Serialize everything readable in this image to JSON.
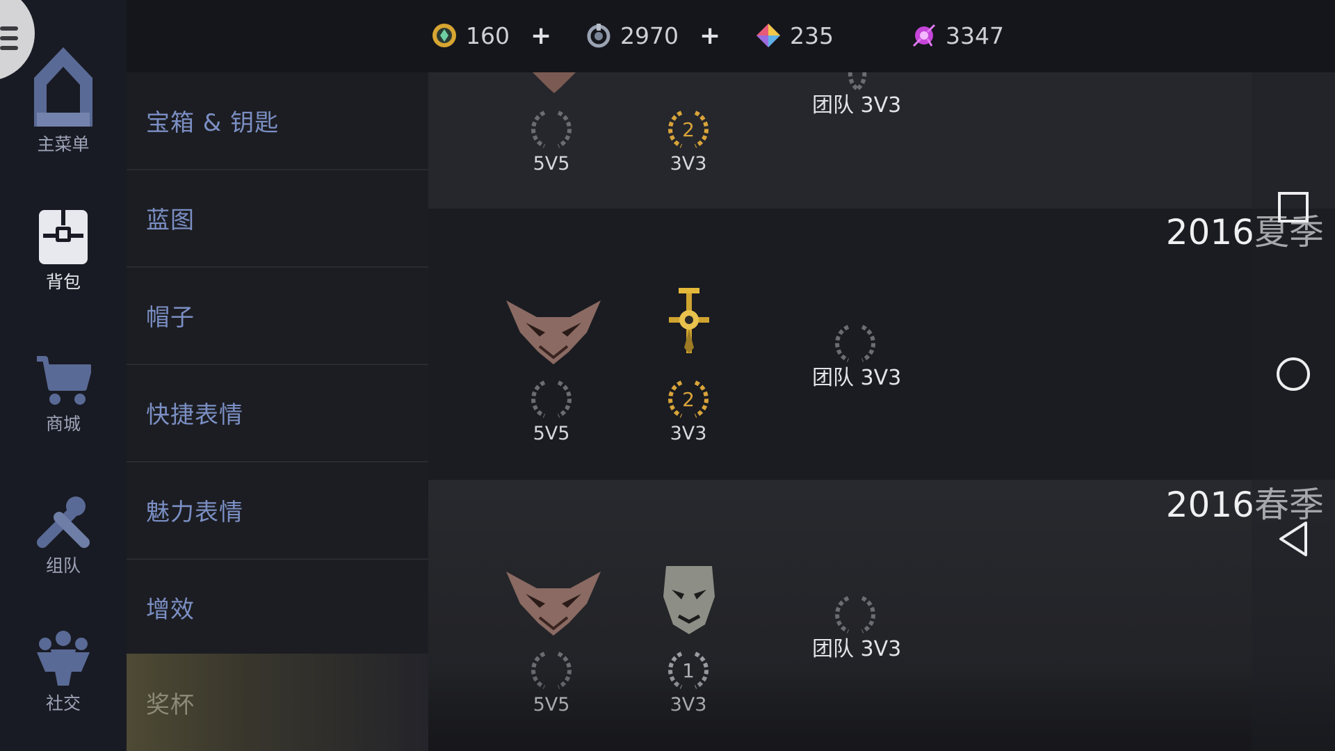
{
  "currency": [
    {
      "icon": "gold-coin-icon",
      "value": "160",
      "plus": "+"
    },
    {
      "icon": "silver-token-icon",
      "value": "2970",
      "plus": "+"
    },
    {
      "icon": "rainbow-gem-icon",
      "value": "235"
    },
    {
      "icon": "purple-crystal-icon",
      "value": "3347"
    }
  ],
  "nav": {
    "items": [
      {
        "label": "主菜单",
        "icon": "home-icon"
      },
      {
        "label": "背包",
        "icon": "backpack-icon"
      },
      {
        "label": "商城",
        "icon": "cart-icon"
      },
      {
        "label": "组队",
        "icon": "team-icon"
      },
      {
        "label": "社交",
        "icon": "social-icon"
      }
    ]
  },
  "categories": [
    {
      "label": "宝箱 & 钥匙"
    },
    {
      "label": "蓝图"
    },
    {
      "label": "帽子"
    },
    {
      "label": "快捷表情"
    },
    {
      "label": "魅力表情"
    },
    {
      "label": "增效"
    },
    {
      "label": "奖杯",
      "active": true
    }
  ],
  "trophy_rows": [
    {
      "season": "",
      "slots": [
        {
          "mode": "5V5",
          "rank": ""
        },
        {
          "mode": "3V3",
          "rank": "2"
        }
      ],
      "team": "团队 3V3"
    },
    {
      "season": "2016夏季",
      "slots": [
        {
          "mode": "5V5",
          "rank": ""
        },
        {
          "mode": "3V3",
          "rank": "2"
        }
      ],
      "team": "团队 3V3"
    },
    {
      "season": "2016春季",
      "slots": [
        {
          "mode": "5V5",
          "rank": ""
        },
        {
          "mode": "3V3",
          "rank": "1"
        }
      ],
      "team": "团队 3V3"
    }
  ],
  "colors": {
    "category_text": "#7b8fc4",
    "gold": "#d9a43a",
    "background": "#1a1b20"
  }
}
